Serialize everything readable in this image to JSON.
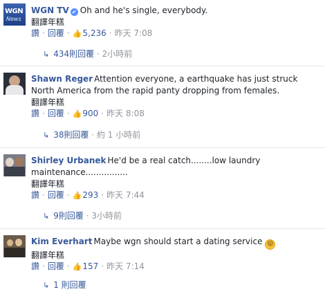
{
  "comments": [
    {
      "author": "WGN TV",
      "verified": true,
      "text": "Oh and he's single, everybody.",
      "translate": "翻譯年糕",
      "like": "讚",
      "reply": "回覆",
      "likes": "5,236",
      "time": "昨天 7:08",
      "replies_count": "434則回覆",
      "replies_time": "2小時前"
    },
    {
      "author": "Shawn Reger",
      "verified": false,
      "text": "Attention everyone, a earthquake has just struck North America from the rapid panty dropping from females.",
      "translate": "翻譯年糕",
      "like": "讚",
      "reply": "回覆",
      "likes": "900",
      "time": "昨天 8:08",
      "replies_count": "38則回覆",
      "replies_time": "約 1 小時前"
    },
    {
      "author": "Shirley Urbanek",
      "verified": false,
      "text": "He'd be a real catch........low laundry maintenance................",
      "translate": "翻譯年糕",
      "like": "讚",
      "reply": "回覆",
      "likes": "293",
      "time": "昨天 7:44",
      "replies_count": "9則回覆",
      "replies_time": "3小時前"
    },
    {
      "author": "Kim Everhart",
      "verified": false,
      "text": "Maybe wgn should start a dating service",
      "translate": "翻譯年糕",
      "like": "讚",
      "reply": "回覆",
      "likes": "157",
      "time": "昨天 7:14",
      "replies_count": "1 則回覆",
      "replies_time": ""
    }
  ],
  "avatars": {
    "wgn_line1": "WGN",
    "wgn_line2": "News"
  },
  "icons": {
    "verified": "verified-badge-icon",
    "like": "thumbs-up-icon",
    "reply_arrow": "reply-arrow-icon",
    "emoji": "tongue-out-emoji-icon"
  },
  "colors": {
    "link": "#365899",
    "meta": "#90949c",
    "text": "#1d2129",
    "verified": "#5890ff",
    "divider": "#e5e6e9"
  }
}
